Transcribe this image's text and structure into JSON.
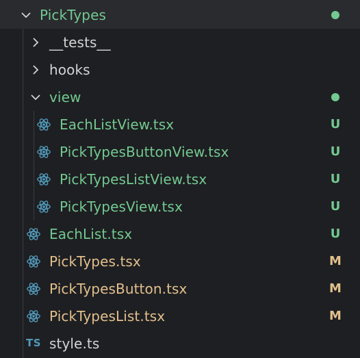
{
  "colors": {
    "background": "#1e1f22",
    "untracked": "#73c991",
    "modified": "#e2c08d",
    "react_icon": "#519aba",
    "ts_icon": "#519aba",
    "default_text": "#d3d4d6"
  },
  "tree": {
    "root": {
      "label": "PickTypes",
      "expanded": true,
      "status_dot": true,
      "icon": "chevron-down-icon"
    },
    "tests_folder": {
      "label": "__tests__",
      "expanded": false,
      "icon": "chevron-right-icon"
    },
    "hooks_folder": {
      "label": "hooks",
      "expanded": false,
      "icon": "chevron-right-icon"
    },
    "view_folder": {
      "label": "view",
      "expanded": true,
      "status_dot": true,
      "icon": "chevron-down-icon"
    },
    "view_files": [
      {
        "label": "EachListView.tsx",
        "badge": "U",
        "icon": "react-icon"
      },
      {
        "label": "PickTypesButtonView.tsx",
        "badge": "U",
        "icon": "react-icon"
      },
      {
        "label": "PickTypesListView.tsx",
        "badge": "U",
        "icon": "react-icon"
      },
      {
        "label": "PickTypesView.tsx",
        "badge": "U",
        "icon": "react-icon"
      }
    ],
    "files": [
      {
        "label": "EachList.tsx",
        "badge": "U",
        "icon": "react-icon"
      },
      {
        "label": "PickTypes.tsx",
        "badge": "M",
        "icon": "react-icon"
      },
      {
        "label": "PickTypesButton.tsx",
        "badge": "M",
        "icon": "react-icon"
      },
      {
        "label": "PickTypesList.tsx",
        "badge": "M",
        "icon": "react-icon"
      }
    ],
    "style_file": {
      "label": "style.ts",
      "icon_text": "TS"
    }
  }
}
